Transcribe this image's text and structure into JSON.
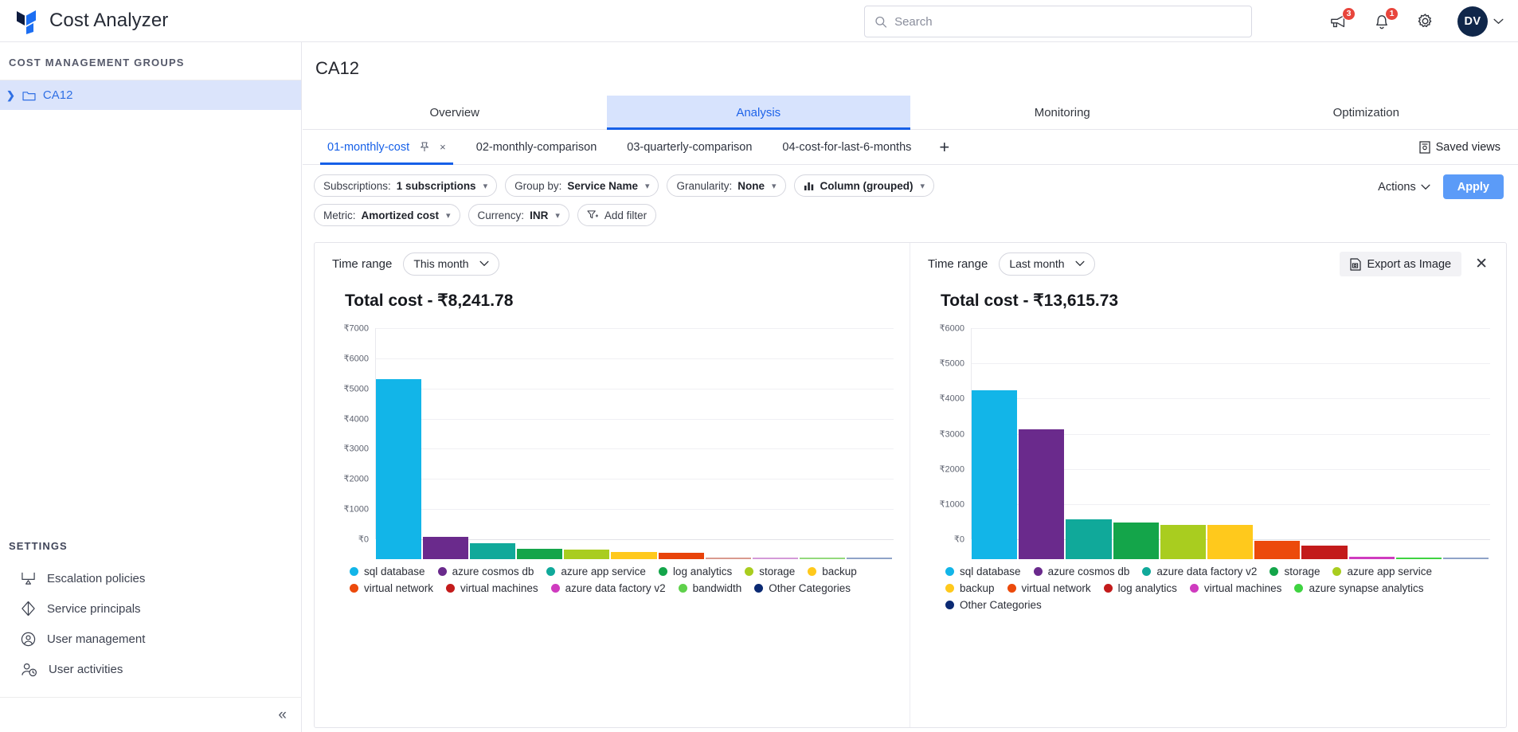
{
  "app": {
    "title": "Cost Analyzer",
    "logo_icon": "terraform-logo-icon"
  },
  "search": {
    "placeholder": "Search",
    "value": "",
    "icon": "search-icon"
  },
  "topbar": {
    "announcements": {
      "icon": "megaphone-icon",
      "badge": "3"
    },
    "notifications": {
      "icon": "bell-icon",
      "badge": "1"
    },
    "settings": {
      "icon": "gear-icon"
    },
    "avatar": {
      "initials": "DV",
      "chevron": "chevron-down-icon"
    }
  },
  "sidebar": {
    "group_header": "COST MANAGEMENT GROUPS",
    "tree": [
      {
        "label": "CA12",
        "expand_icon": "chevron-right-icon",
        "folder_icon": "folder-icon",
        "selected": true
      }
    ],
    "settings_header": "SETTINGS",
    "settings_items": [
      {
        "label": "Escalation policies",
        "icon": "escalation-icon"
      },
      {
        "label": "Service principals",
        "icon": "diamond-icon"
      },
      {
        "label": "User management",
        "icon": "user-circle-icon"
      },
      {
        "label": "User activities",
        "icon": "user-clock-icon"
      }
    ],
    "collapse": {
      "icon": "collapse-double-chevron-icon",
      "glyph": "«"
    }
  },
  "main": {
    "page_title": "CA12",
    "tabs": [
      {
        "label": "Overview",
        "active": false
      },
      {
        "label": "Analysis",
        "active": true
      },
      {
        "label": "Monitoring",
        "active": false
      },
      {
        "label": "Optimization",
        "active": false
      }
    ],
    "subtabs": [
      {
        "label": "01-monthly-cost",
        "active": true,
        "pin_icon": "pin-icon",
        "close_icon": "close-icon",
        "close_glyph": "×"
      },
      {
        "label": "02-monthly-comparison",
        "active": false
      },
      {
        "label": "03-quarterly-comparison",
        "active": false
      },
      {
        "label": "04-cost-for-last-6-months",
        "active": false
      }
    ],
    "add_tab": {
      "label": "+",
      "icon": "add-tab-icon"
    },
    "saved_views": {
      "label": "Saved views",
      "icon": "saved-views-icon"
    }
  },
  "filters": {
    "pills": [
      {
        "prefix": "Subscriptions:",
        "value": "1 subscriptions",
        "chevron": "⌄",
        "icon": null
      },
      {
        "prefix": "Group by:",
        "value": "Service Name",
        "chevron": "⌄",
        "icon": null
      },
      {
        "prefix": "Granularity:",
        "value": "None",
        "chevron": "⌄",
        "icon": null
      },
      {
        "prefix": "",
        "value": "Column (grouped)",
        "chevron": "⌄",
        "icon": "bar-chart-icon"
      },
      {
        "prefix": "Metric:",
        "value": "Amortized cost",
        "chevron": "⌄",
        "icon": null
      },
      {
        "prefix": "Currency:",
        "value": "INR",
        "chevron": "⌄",
        "icon": null
      },
      {
        "prefix": "",
        "value": "Add filter",
        "chevron": "",
        "icon": "filter-plus-icon"
      }
    ],
    "actions_label": "Actions",
    "actions_chevron": "chevron-down-icon",
    "apply_label": "Apply"
  },
  "panel": {
    "left": {
      "time_range_label": "Time range",
      "time_range_value": "This month",
      "chart_title": "Total cost - ₹8,241.78"
    },
    "right": {
      "time_range_label": "Time range",
      "time_range_value": "Last month",
      "chart_title": "Total cost - ₹13,615.73"
    },
    "export_label": "Export as Image",
    "export_icon": "export-image-icon",
    "close_icon": "close-panel-icon",
    "close_glyph": "✕"
  },
  "chart_data": [
    {
      "type": "bar",
      "title": "Total cost - ₹8,241.78",
      "panel": "This month",
      "xlabel": "",
      "ylabel": "",
      "ylim": [
        0,
        7000
      ],
      "yticks": [
        0,
        1000,
        2000,
        3000,
        4000,
        5000,
        6000,
        7000
      ],
      "ytick_labels": [
        "₹0",
        "₹1000",
        "₹2000",
        "₹3000",
        "₹4000",
        "₹5000",
        "₹6000",
        "₹7000"
      ],
      "grid": true,
      "legend_position": "bottom",
      "categories": [
        "sql database",
        "azure cosmos db",
        "azure app service",
        "log analytics",
        "storage",
        "backup",
        "virtual network",
        "virtual machines",
        "azure data factory v2",
        "bandwidth",
        "Other Categories"
      ],
      "values": [
        5960,
        735,
        520,
        350,
        310,
        225,
        215,
        22,
        16,
        14,
        12
      ],
      "colors": [
        "#12b5e8",
        "#6a2a8c",
        "#10a99a",
        "#14a54a",
        "#a9cd1f",
        "#ffc91c",
        "#ec4a0b",
        "#c31b1b",
        "#cf3bbf",
        "#5fd14b",
        "#0b2a73"
      ],
      "bar_render_colors": [
        "#12b5e8",
        "#6a2a8c",
        "#10a99a",
        "#14a54a",
        "#a9cd1f",
        "#ffc91c",
        "#e8420a",
        "#d99a8f",
        "#d49ad8",
        "#93d97c",
        "#8fa3c8"
      ]
    },
    {
      "type": "bar",
      "title": "Total cost - ₹13,615.73",
      "panel": "Last month",
      "xlabel": "",
      "ylabel": "",
      "ylim": [
        0,
        6000
      ],
      "yticks": [
        0,
        1000,
        2000,
        3000,
        4000,
        5000,
        6000
      ],
      "ytick_labels": [
        "₹0",
        "₹1000",
        "₹2000",
        "₹3000",
        "₹4000",
        "₹5000",
        "₹6000"
      ],
      "grid": true,
      "legend_position": "bottom",
      "categories": [
        "sql database",
        "azure cosmos db",
        "azure data factory v2",
        "storage",
        "azure app service",
        "backup",
        "virtual network",
        "log analytics",
        "virtual machines",
        "azure synapse analytics",
        "Other Categories"
      ],
      "values": [
        4800,
        3680,
        1140,
        1050,
        985,
        980,
        530,
        380,
        75,
        30,
        12
      ],
      "colors": [
        "#12b5e8",
        "#6a2a8c",
        "#10a99a",
        "#14a54a",
        "#a9cd1f",
        "#ffc91c",
        "#ec4a0b",
        "#c31b1b",
        "#cf3bbf",
        "#3fd341",
        "#0b2a73"
      ],
      "bar_render_colors": [
        "#12b5e8",
        "#6a2a8c",
        "#10a99a",
        "#14a54a",
        "#a9cd1f",
        "#ffc91c",
        "#ec4a0b",
        "#c31b1b",
        "#cf3bbf",
        "#3fd341",
        "#8fa3c8"
      ]
    }
  ]
}
